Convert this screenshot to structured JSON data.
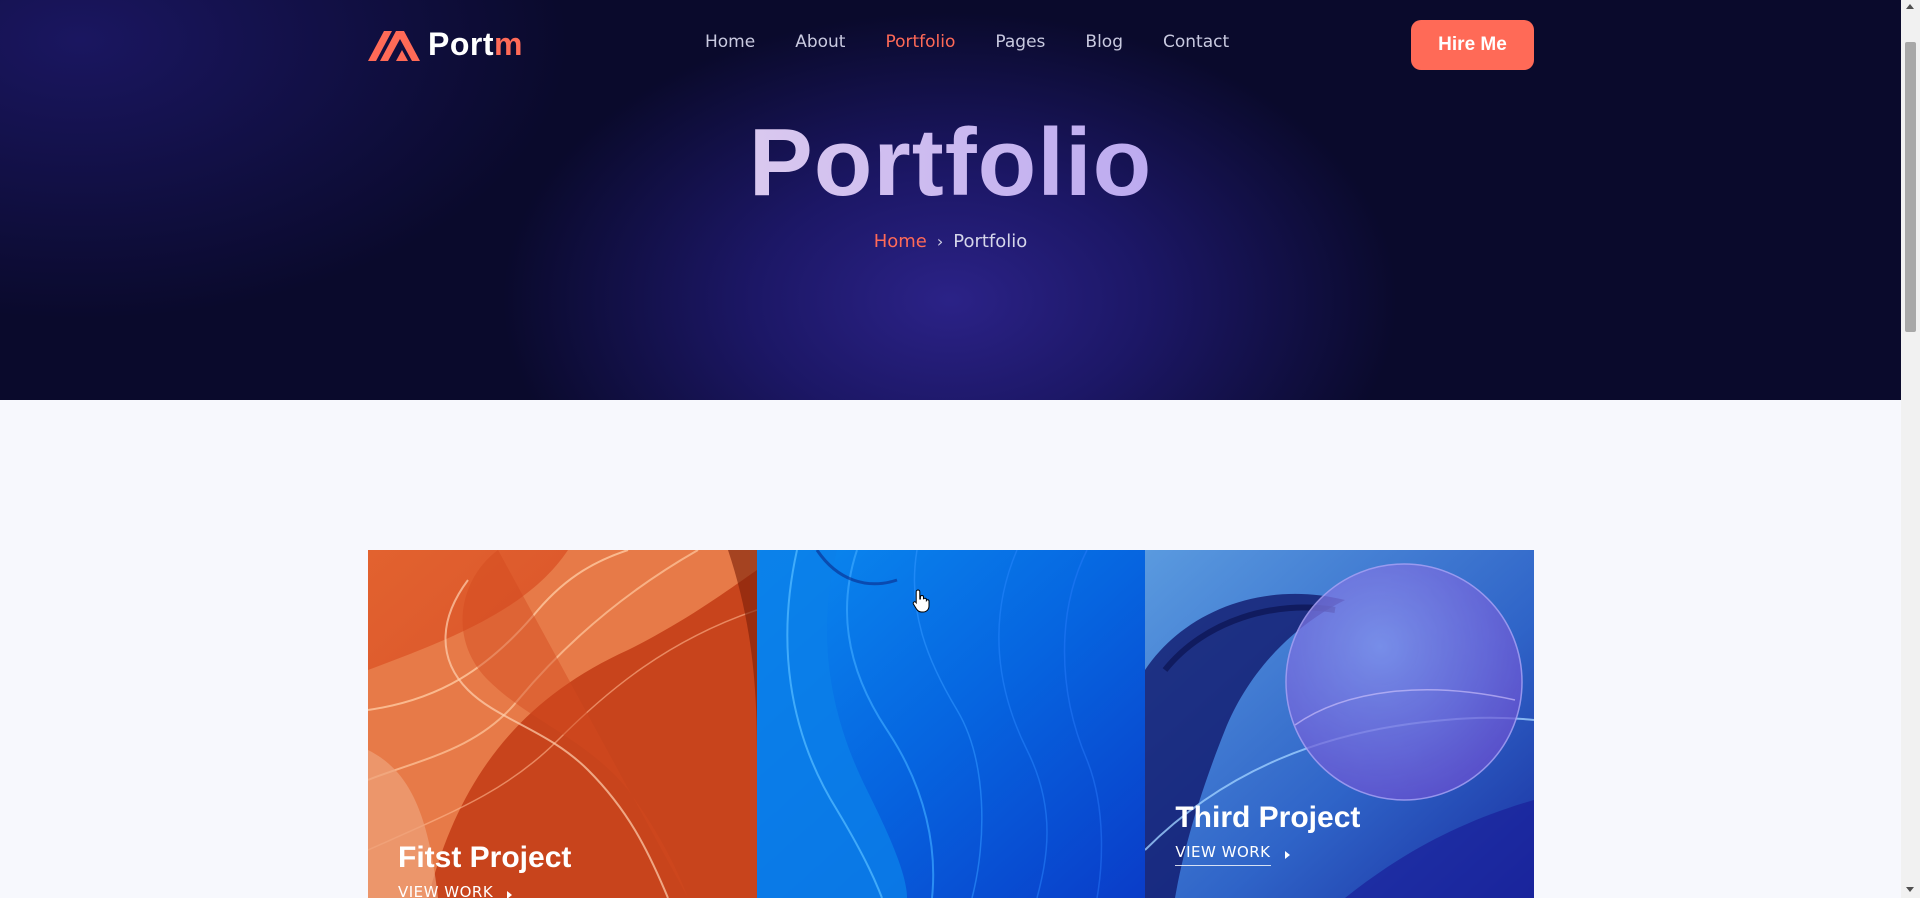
{
  "header": {
    "logo_text_main": "Port",
    "logo_text_accent": "m",
    "logo_icon": "brand-mountain-icon",
    "nav": [
      {
        "label": "Home",
        "active": false
      },
      {
        "label": "About",
        "active": false
      },
      {
        "label": "Portfolio",
        "active": true
      },
      {
        "label": "Pages",
        "active": false
      },
      {
        "label": "Blog",
        "active": false
      },
      {
        "label": "Contact",
        "active": false
      }
    ],
    "cta_label": "Hire Me"
  },
  "hero": {
    "title": "Portfolio",
    "breadcrumb": {
      "home": "Home",
      "separator": "›",
      "current": "Portfolio"
    }
  },
  "portfolio": {
    "projects": [
      {
        "title": "Fitst Project",
        "link_label": "VIEW WORK"
      },
      {
        "title": "",
        "link_label": ""
      },
      {
        "title": "Third Project",
        "link_label": "VIEW WORK"
      }
    ]
  },
  "colors": {
    "accent": "#ff6a57",
    "hero_bg": "#0a0a2c",
    "page_bg": "#f7f8fd"
  }
}
